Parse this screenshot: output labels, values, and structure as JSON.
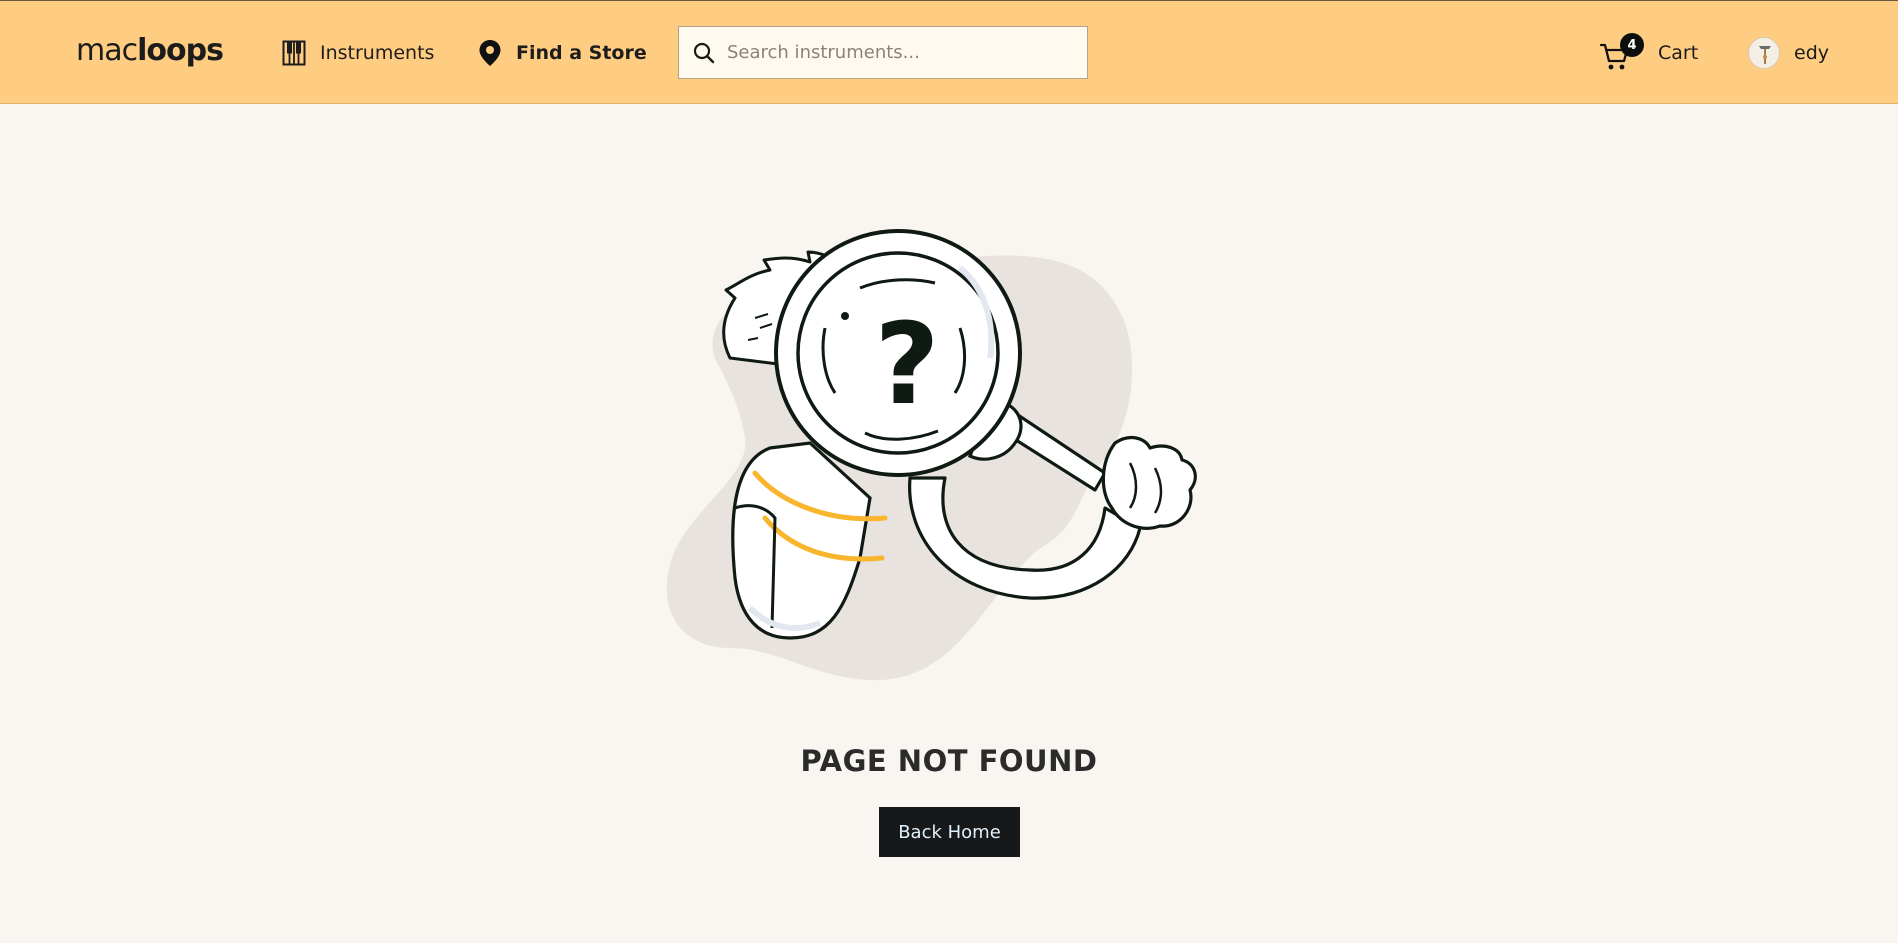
{
  "header": {
    "logo_light": "mac",
    "logo_bold": "loops",
    "nav": {
      "instruments_label": "Instruments",
      "store_label": "Find a Store"
    },
    "search": {
      "placeholder": "Search instruments...",
      "value": ""
    },
    "cart": {
      "label": "Cart",
      "count": "4"
    },
    "user": {
      "name": "edy"
    }
  },
  "main": {
    "title": "PAGE NOT FOUND",
    "back_button_label": "Back Home"
  },
  "icons": {
    "instruments": "piano-keys-icon",
    "store": "map-pin-icon",
    "search": "search-icon",
    "cart": "shopping-cart-icon"
  },
  "colors": {
    "header_bg": "#ffcd82",
    "page_bg": "#f9f6f2",
    "button_bg": "#17181a",
    "button_text": "#e0f2fb",
    "accent_stripe": "#f9b52b"
  }
}
